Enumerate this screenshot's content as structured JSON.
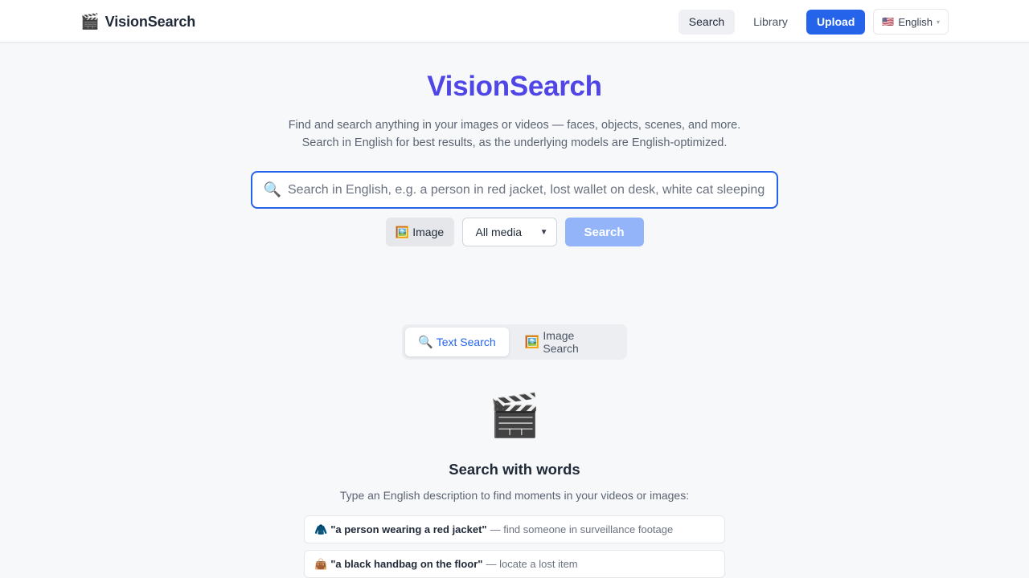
{
  "header": {
    "logo_icon": "clapper-board-icon",
    "logo_glyph": "🎬",
    "brand": "VisionSearch",
    "nav": {
      "search": "Search",
      "library": "Library",
      "upload": "Upload"
    },
    "language": {
      "flag": "🇺🇸",
      "label": "English",
      "caret": "▾"
    }
  },
  "hero": {
    "title": "VisionSearch",
    "subtitle_line1": "Find and search anything in your images or videos — faces, objects, scenes, and more.",
    "subtitle_line2": "Search in English for best results, as the underlying models are English-optimized."
  },
  "search": {
    "icon_glyph": "🔍",
    "placeholder": "Search in English, e.g. a person in red jacket, lost wallet on desk, white cat sleeping",
    "value": "",
    "image_button": {
      "icon_glyph": "🖼️",
      "label": "Image"
    },
    "media_filter": {
      "selected": "All media",
      "caret": "⌄"
    },
    "submit_label": "Search"
  },
  "mode_tabs": [
    {
      "icon_glyph": "🔍",
      "label": "Text Search",
      "active": true
    },
    {
      "icon_glyph": "🖼️",
      "label": "Image Search",
      "active": false
    }
  ],
  "empty_state": {
    "icon_glyph": "🎬",
    "title": "Search with words",
    "description": "Type an English description to find moments in your videos or images:",
    "examples": [
      {
        "icon_glyph": "🧥",
        "query": "\"a person wearing a red jacket\"",
        "note": "— find someone in surveillance footage"
      },
      {
        "icon_glyph": "👜",
        "query": "\"a black handbag on the floor\"",
        "note": "— locate a lost item"
      }
    ]
  },
  "colors": {
    "accent": "#4f46e5",
    "primary": "#2563eb",
    "primary_disabled": "#93b4f8",
    "background": "#f7f8fa"
  }
}
